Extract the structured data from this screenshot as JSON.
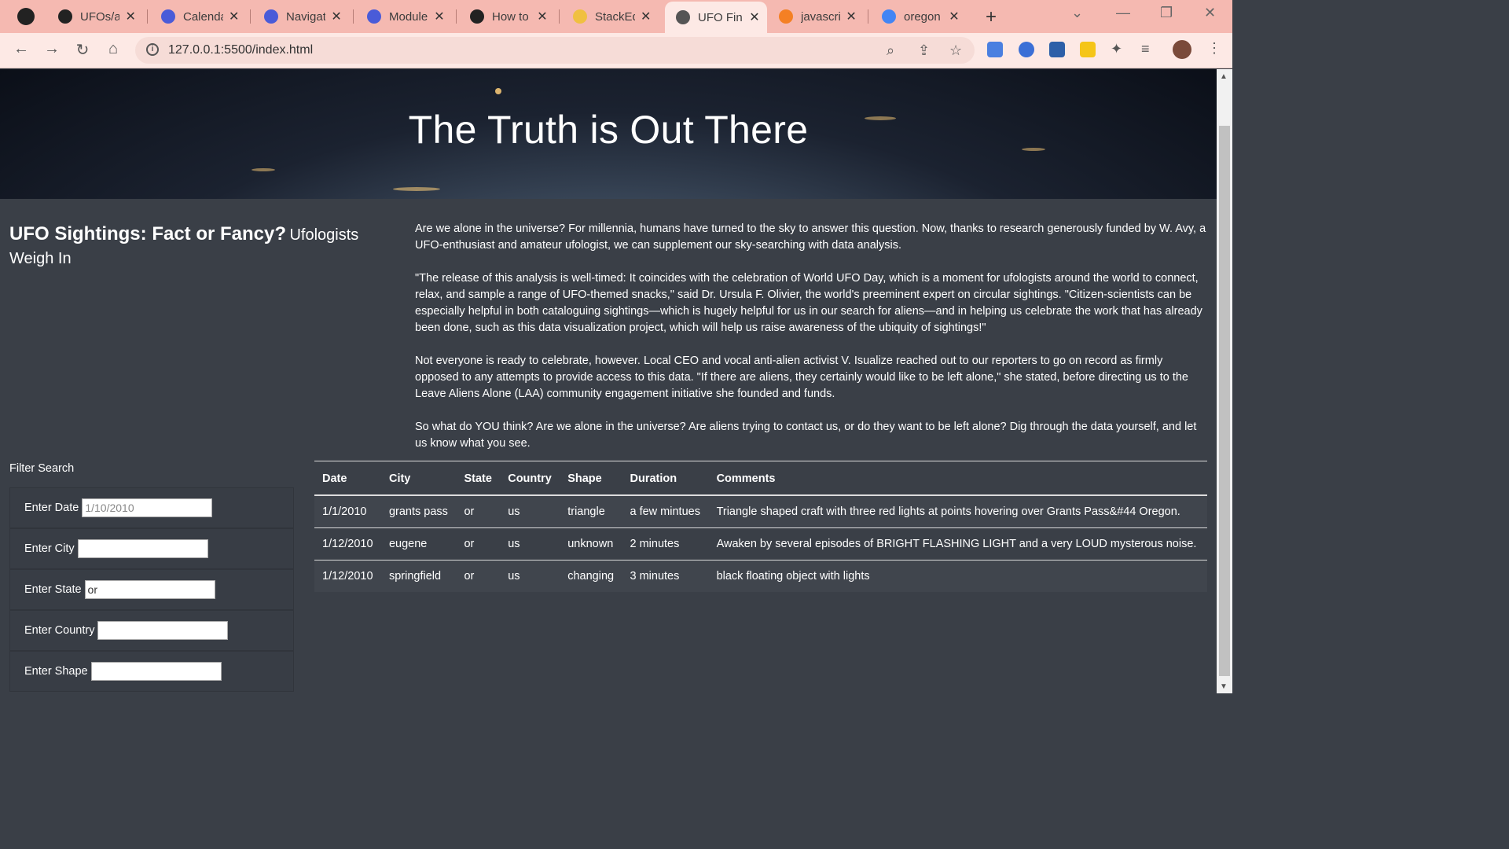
{
  "browser": {
    "tabs": [
      {
        "title": "UFOs/a",
        "fav": "#222"
      },
      {
        "title": "Calenda",
        "fav": "#4a5bd8"
      },
      {
        "title": "Navigat",
        "fav": "#4a5bd8"
      },
      {
        "title": "Module",
        "fav": "#4a5bd8"
      },
      {
        "title": "How to",
        "fav": "#222"
      },
      {
        "title": "StackEd",
        "fav": "#f0c040"
      },
      {
        "title": "UFO Fin",
        "fav": "#555"
      },
      {
        "title": "javascri",
        "fav": "#f48024"
      },
      {
        "title": "oregon",
        "fav": "#4285f4"
      }
    ],
    "url": "127.0.0.1:5500/index.html"
  },
  "hero": {
    "title": "The Truth is Out There"
  },
  "heading": {
    "main": "UFO Sightings: Fact or Fancy?",
    "sub": "Ufologists Weigh In"
  },
  "article": {
    "p1": "Are we alone in the universe? For millennia, humans have turned to the sky to answer this question. Now, thanks to research generously funded by W. Avy, a UFO-enthusiast and amateur ufologist, we can supplement our sky-searching with data analysis.",
    "p2": "\"The release of this analysis is well-timed: It coincides with the celebration of World UFO Day, which is a moment for ufologists around the world to connect, relax, and sample a range of UFO-themed snacks,\" said Dr. Ursula F. Olivier, the world's preeminent expert on circular sightings. \"Citizen-scientists can be especially helpful in both cataloguing sightings—which is hugely helpful for us in our search for aliens—and in helping us celebrate the work that has already been done, such as this data visualization project, which will help us raise awareness of the ubiquity of sightings!\"",
    "p3": "Not everyone is ready to celebrate, however. Local CEO and vocal anti-alien activist V. Isualize reached out to our reporters to go on record as firmly opposed to any attempts to provide access to this data. \"If there are aliens, they certainly would like to be left alone,\" she stated, before directing us to the Leave Aliens Alone (LAA) community engagement initiative she founded and funds.",
    "p4": "So what do YOU think? Are we alone in the universe? Are aliens trying to contact us, or do they want to be left alone? Dig through the data yourself, and let us know what you see."
  },
  "filters": {
    "title": "Filter Search",
    "items": [
      {
        "label": "Enter Date",
        "value": "",
        "placeholder": "1/10/2010"
      },
      {
        "label": "Enter City",
        "value": "",
        "placeholder": ""
      },
      {
        "label": "Enter State",
        "value": "or",
        "placeholder": ""
      },
      {
        "label": "Enter Country",
        "value": "",
        "placeholder": ""
      },
      {
        "label": "Enter Shape",
        "value": "",
        "placeholder": ""
      }
    ]
  },
  "table": {
    "headers": [
      "Date",
      "City",
      "State",
      "Country",
      "Shape",
      "Duration",
      "Comments"
    ],
    "rows": [
      [
        "1/1/2010",
        "grants pass",
        "or",
        "us",
        "triangle",
        "a few mintues",
        "Triangle shaped craft with three red lights at points hovering over Grants Pass&#44 Oregon."
      ],
      [
        "1/12/2010",
        "eugene",
        "or",
        "us",
        "unknown",
        "2 minutes",
        "Awaken by several episodes of BRIGHT FLASHING LIGHT and a very LOUD mysterous noise."
      ],
      [
        "1/12/2010",
        "springfield",
        "or",
        "us",
        "changing",
        "3 minutes",
        "black floating object with lights"
      ]
    ]
  }
}
